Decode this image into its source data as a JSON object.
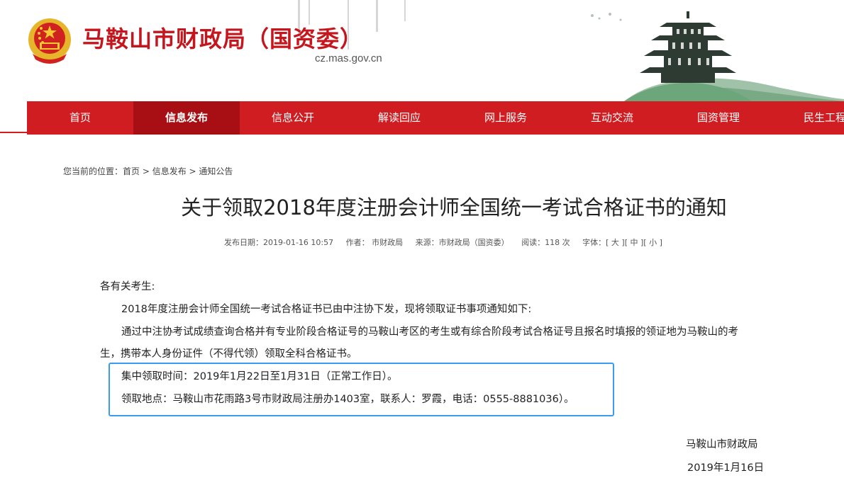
{
  "header": {
    "site_title": "马鞍山市财政局（国资委）",
    "domain": "cz.mas.gov.cn"
  },
  "nav": {
    "items": [
      {
        "label": "首页",
        "active": false
      },
      {
        "label": "信息发布",
        "active": true
      },
      {
        "label": "信息公开",
        "active": false
      },
      {
        "label": "解读回应",
        "active": false
      },
      {
        "label": "网上服务",
        "active": false
      },
      {
        "label": "互动交流",
        "active": false
      },
      {
        "label": "国资管理",
        "active": false
      },
      {
        "label": "民生工程",
        "active": false
      }
    ]
  },
  "breadcrumb": {
    "prefix": "您当前的位置：",
    "items": [
      "首页",
      "信息发布",
      "通知公告"
    ],
    "separator": " > "
  },
  "article": {
    "title": "关于领取2018年度注册会计师全国统一考试合格证书的通知",
    "meta": {
      "date": "发布日期：2019-01-16 10:57",
      "author": "作者：  市财政局",
      "source": "来源：市财政局（国资委）",
      "views": "阅读：118 次",
      "font_label": "字体：",
      "font_large": "[ 大 ]",
      "font_medium": "[ 中 ]",
      "font_small": "[ 小 ]"
    },
    "greeting": "各有关考生:",
    "para1": "2018年度注册会计师全国统一考试合格证书已由中注协下发，现将领取证书事项通知如下:",
    "para2_line1": "通过中注协考试成绩查询合格并有专业阶段合格证号的马鞍山考区的考生或有综合阶段考试合格证号且报名时填报的领证地为马鞍山的考",
    "para2_line2": "生，携带本人身份证件（不得代领）领取全科合格证书。",
    "time_line": "集中领取时间：2019年1月22日至1月31日（正常工作日）。",
    "place_line": "领取地点：马鞍山市花雨路3号市财政局注册办1403室，联系人：罗霞，电话：0555-8881036）。",
    "signature": "马鞍山市财政局",
    "sign_date": "2019年1月16日"
  },
  "colors": {
    "brand_red": "#cf1d22",
    "active_nav": "#a80f14",
    "highlight_border": "#3a9cf0"
  }
}
